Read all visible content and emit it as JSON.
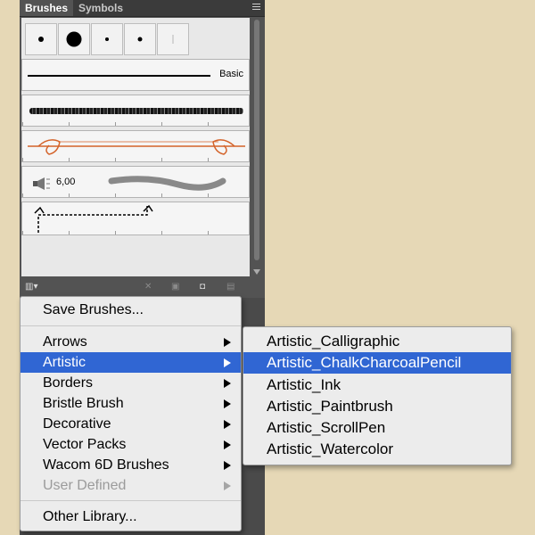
{
  "tabs": [
    "Brushes",
    "Symbols"
  ],
  "brushes": {
    "basic_label": "Basic",
    "size_value": "6,00"
  },
  "menu": {
    "items": [
      {
        "label": "Save Brushes...",
        "submenu": false
      },
      {
        "label": "Arrows",
        "submenu": true
      },
      {
        "label": "Artistic",
        "submenu": true,
        "highlighted": true
      },
      {
        "label": "Borders",
        "submenu": true
      },
      {
        "label": "Bristle Brush",
        "submenu": true
      },
      {
        "label": "Decorative",
        "submenu": true
      },
      {
        "label": "Vector Packs",
        "submenu": true
      },
      {
        "label": "Wacom 6D Brushes",
        "submenu": true
      },
      {
        "label": "User Defined",
        "submenu": true,
        "disabled": true
      },
      {
        "label": "Other Library...",
        "submenu": false
      }
    ]
  },
  "submenu": {
    "items": [
      {
        "label": "Artistic_Calligraphic"
      },
      {
        "label": "Artistic_ChalkCharcoalPencil",
        "highlighted": true
      },
      {
        "label": "Artistic_Ink"
      },
      {
        "label": "Artistic_Paintbrush"
      },
      {
        "label": "Artistic_ScrollPen"
      },
      {
        "label": "Artistic_Watercolor"
      }
    ]
  },
  "colors": {
    "highlight": "#3066d3",
    "background": "#e6d8b6",
    "panel": "#535353",
    "arrow_brush": "#d4632a"
  }
}
